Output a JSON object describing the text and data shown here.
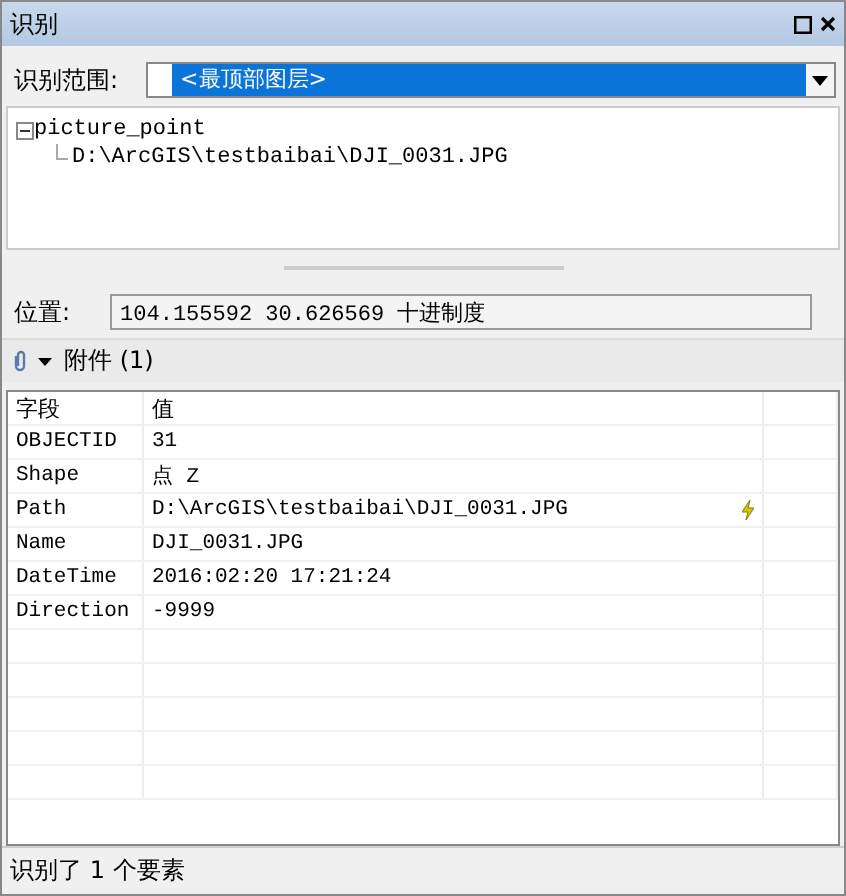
{
  "window": {
    "title": "识别"
  },
  "scope": {
    "label": "识别范围:",
    "value": "<最顶部图层>"
  },
  "tree": [
    {
      "label": "picture_point",
      "expanded": true,
      "children": [
        {
          "label": "D:\\ArcGIS\\testbaibai\\DJI_0031.JPG"
        }
      ]
    }
  ],
  "location": {
    "label": "位置:",
    "value": "104.155592   30.626569 十进制度"
  },
  "attachments": {
    "label": "附件 (1)"
  },
  "table": {
    "columns": [
      "字段",
      "值"
    ],
    "rows": [
      {
        "field": "OBJECTID",
        "value": "31"
      },
      {
        "field": "Shape",
        "value": "点 Z"
      },
      {
        "field": "Path",
        "value": "D:\\ArcGIS\\testbaibai\\DJI_0031.JPG",
        "hyperlink": true
      },
      {
        "field": "Name",
        "value": "DJI_0031.JPG"
      },
      {
        "field": "DateTime",
        "value": "2016:02:20 17:21:24"
      },
      {
        "field": "Direction",
        "value": "-9999"
      }
    ]
  },
  "status_bar": "识别了 1 个要素"
}
